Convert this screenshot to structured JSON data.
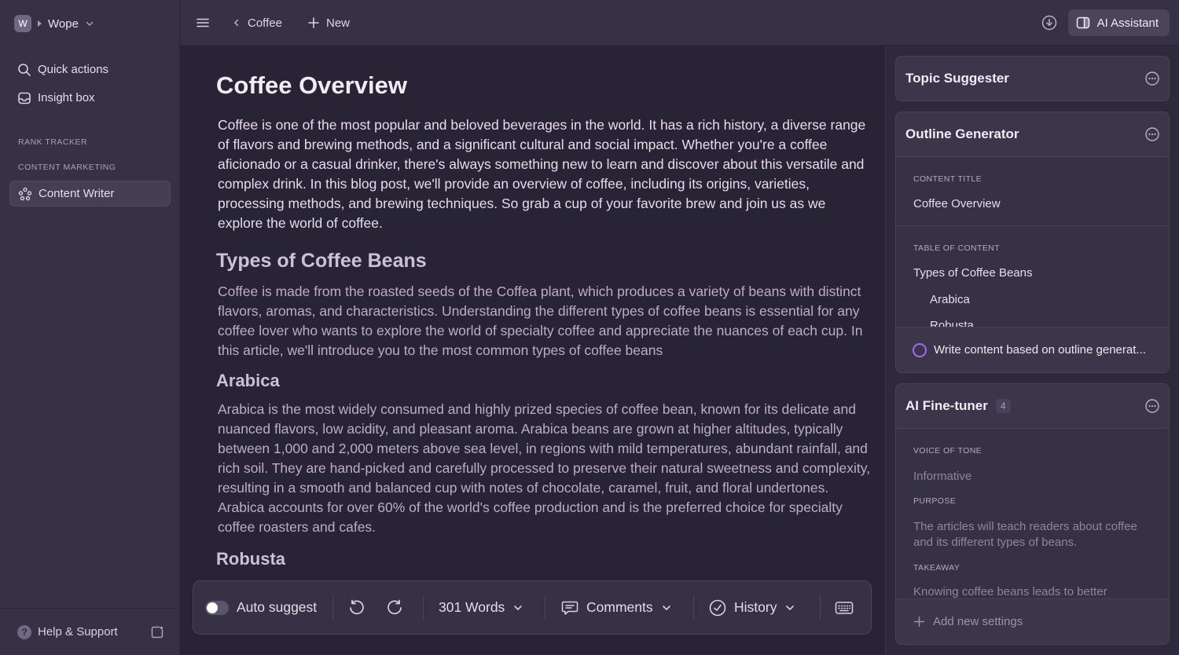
{
  "sidebar": {
    "workspace": {
      "initial": "W",
      "name": "Wope"
    },
    "nav": [
      {
        "label": "Quick actions",
        "icon": "search-icon"
      },
      {
        "label": "Insight box",
        "icon": "inbox-icon"
      }
    ],
    "sections": [
      "RANK TRACKER",
      "CONTENT MARKETING"
    ],
    "active_item": {
      "label": "Content Writer",
      "icon": "writer-icon"
    },
    "footer": {
      "help_label": "Help & Support",
      "help_icon": "?"
    }
  },
  "topbar": {
    "breadcrumb": "Coffee",
    "new_label": "New",
    "ai_label": "AI Assistant"
  },
  "doc": {
    "title": "Coffee Overview",
    "intro": "Coffee is one of the most popular and beloved beverages in the world. It has a rich history, a diverse range of flavors and brewing methods, and a significant cultural and social impact. Whether you're a coffee aficionado or a casual drinker, there's always something new to learn and discover about this versatile and complex drink. In this blog post, we'll provide an overview of coffee, including its origins, varieties, processing methods, and brewing techniques. So grab a cup of your favorite brew and join us as we explore the world of coffee.",
    "h2": "Types of Coffee Beans",
    "types_text": "Coffee is made from the roasted seeds of the Coffea plant, which produces a variety of beans with distinct flavors, aromas, and characteristics. Understanding the different types of coffee beans is essential for any coffee lover who wants to explore the world of specialty coffee and appreciate the nuances of each cup. In this article, we'll introduce you to the most common types of coffee beans",
    "h3_arabica": "Arabica",
    "arabica_text": "Arabica is the most widely consumed and highly prized species of coffee bean, known for its delicate and nuanced flavors, low acidity, and pleasant aroma. Arabica beans are grown at higher altitudes, typically between 1,000 and 2,000 meters above sea level, in regions with mild temperatures, abundant rainfall, and rich soil. They are hand-picked and carefully processed to preserve their natural sweetness and complexity, resulting in a smooth and balanced cup with notes of chocolate, caramel, fruit, and floral undertones. Arabica accounts for over 60% of the world's coffee production and is the preferred choice for specialty coffee roasters and cafes.",
    "h3_robusta": "Robusta"
  },
  "toolbar": {
    "auto_suggest": "Auto suggest",
    "auto_suggest_on": false,
    "words": "301 Words",
    "comments": "Comments",
    "history": "History"
  },
  "panel": {
    "topic": {
      "title": "Topic Suggester"
    },
    "outline": {
      "title": "Outline Generator",
      "content_title_label": "CONTENT TITLE",
      "content_title": "Coffee Overview",
      "toc_label": "TABLE OF CONTENT",
      "toc": [
        "Types of Coffee Beans",
        "Arabica",
        "Robusta"
      ],
      "write_label": "Write content based on outline generat..."
    },
    "finetuner": {
      "title": "AI Fine-tuner",
      "count": "4",
      "voice_label": "VOICE OF TONE",
      "voice_value": "Informative",
      "purpose_label": "PURPOSE",
      "purpose_value": "The articles will teach readers about coffee and its different types of beans.",
      "takeaway_label": "TAKEAWAY",
      "takeaway_value": "Knowing coffee beans leads to better",
      "add_label": "Add new settings"
    }
  },
  "colors": {
    "accent_ring": "#9d6ef0",
    "sidebar_bg": "#363144",
    "editor_bg": "#282335"
  }
}
